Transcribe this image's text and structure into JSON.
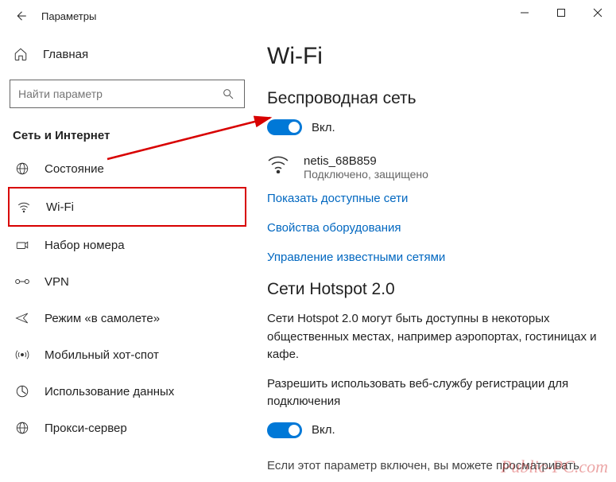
{
  "window": {
    "title": "Параметры"
  },
  "sidebar": {
    "home": "Главная",
    "search_placeholder": "Найти параметр",
    "section": "Сеть и Интернет",
    "items": [
      {
        "label": "Состояние"
      },
      {
        "label": "Wi-Fi"
      },
      {
        "label": "Набор номера"
      },
      {
        "label": "VPN"
      },
      {
        "label": "Режим «в самолете»"
      },
      {
        "label": "Мобильный хот-спот"
      },
      {
        "label": "Использование данных"
      },
      {
        "label": "Прокси-сервер"
      }
    ]
  },
  "content": {
    "heading": "Wi-Fi",
    "wireless_section": "Беспроводная сеть",
    "toggle1_label": "Вкл.",
    "network": {
      "name": "netis_68B859",
      "status": "Подключено, защищено"
    },
    "link_show_networks": "Показать доступные сети",
    "link_hardware": "Свойства оборудования",
    "link_known": "Управление известными сетями",
    "hotspot_section": "Сети Hotspot 2.0",
    "hotspot_desc": "Сети Hotspot 2.0 могут быть доступны в некоторых общественных местах, например аэропортах, гостиницах и кафе.",
    "hotspot_permission": "Разрешить использовать веб-службу регистрации для подключения",
    "toggle2_label": "Вкл.",
    "footer_text": "Если этот параметр включен, вы можете просматривать"
  },
  "watermark": "Public-PC.com"
}
